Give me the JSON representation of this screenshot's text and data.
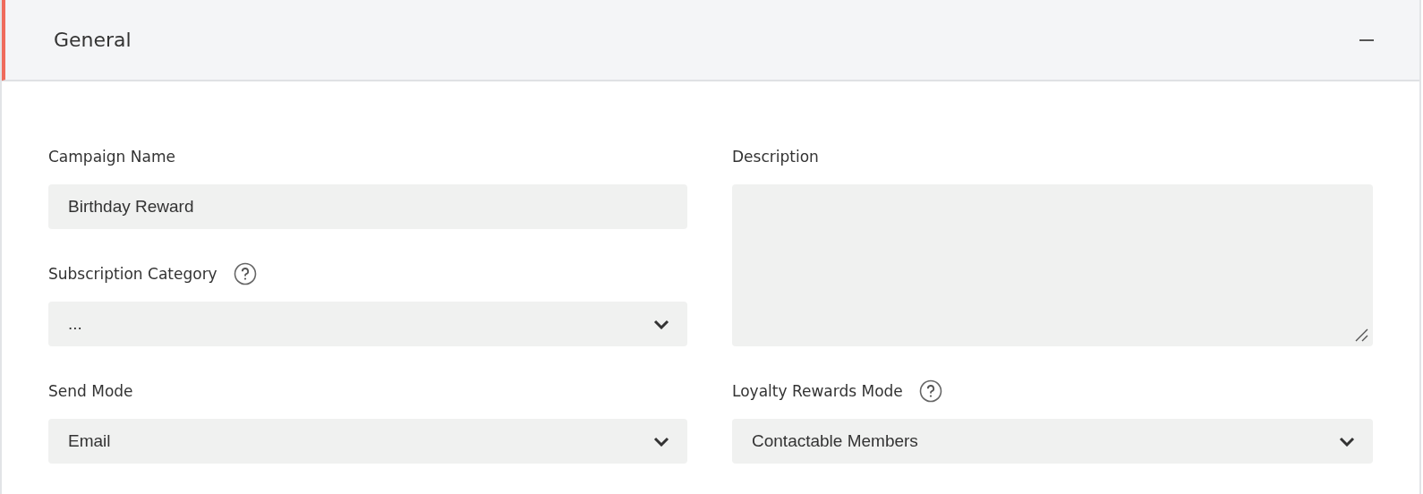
{
  "section": {
    "title": "General",
    "expanded": true
  },
  "fields": [
    {
      "kind": "text",
      "label": "Campaign Name",
      "help": false,
      "value": "Birthday Reward"
    },
    {
      "kind": "textarea",
      "label": "Description",
      "help": false
    },
    {
      "kind": "select",
      "label": "Subscription Category",
      "help": true,
      "value": "..."
    },
    {
      "kind": "select",
      "label": "Send Mode",
      "help": false,
      "value": "Email"
    },
    {
      "kind": "select",
      "label": "Loyalty Rewards Mode",
      "help": true,
      "value": "Contactable Members"
    }
  ]
}
